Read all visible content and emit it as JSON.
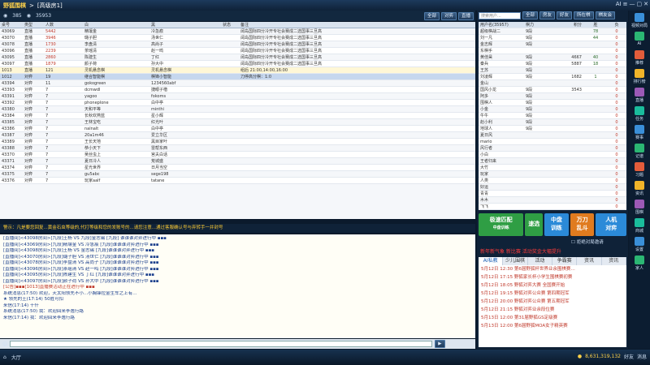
{
  "app": {
    "title": "野狐围棋",
    "room": "[高级房1]",
    "controls": [
      "AI",
      "≡",
      "—",
      "▢",
      "✕"
    ]
  },
  "info": {
    "num1": "385",
    "num2": "35953",
    "buttons": [
      "全部",
      "对弈",
      "直播"
    ]
  },
  "table": {
    "headers": [
      "桌号",
      "类型",
      "人数",
      "白",
      "黑",
      "状态",
      "备注"
    ],
    "rows": [
      [
        "43069",
        "直播",
        "5442",
        "精壤金",
        "冷急痕",
        "",
        "阔岛国际四分冷开专社会赛成二选国事三旦高"
      ],
      [
        "43070",
        "直播",
        "3946",
        "璐子胆",
        "汤世仁",
        "",
        "阔岛国际四分冷开专社会赛成二选国事三旦高"
      ],
      [
        "43078",
        "直播",
        "1730",
        "李盘清",
        "高尚子",
        "",
        "阔岛国际四分冷开专社会赛成二选国事三旦高"
      ],
      [
        "43096",
        "直播",
        "2239",
        "茶瑶清",
        "赵一鸣",
        "",
        "阔岛国际四分冷开专社会赛成二选国事三旦高"
      ],
      [
        "43095",
        "直播",
        "2860",
        "陈建生",
        "丁红",
        "",
        "阔岛国际四分冷开专社会赛成二选国事三旦高"
      ],
      [
        "43097",
        "直播",
        "1879",
        "颜子荷",
        "孙大中",
        "",
        "阔岛国际四分冷开专社会赛成二选国事三旦高"
      ],
      [
        "1013",
        "直播",
        "121",
        "灵机悬念棋",
        "灵机悬念棋",
        "",
        "组后 21:00,14:00,16:00"
      ],
      [
        "1012",
        "对弈",
        "19",
        "继合智能棋",
        "棋锋小智能",
        "",
        "刀停高分棋：1:0"
      ],
      [
        "43394",
        "对弈",
        "11",
        "gokogreen",
        "1234560abf",
        "",
        ""
      ],
      [
        "43393",
        "对弈",
        "7",
        "dcmwdl",
        "捷眼子楷",
        "",
        ""
      ],
      [
        "43391",
        "对弈",
        "7",
        "yagoo",
        "fokoms",
        "",
        ""
      ],
      [
        "43392",
        "对弈",
        "7",
        "phoneplone",
        "白中亭",
        "",
        ""
      ],
      [
        "43380",
        "对弈",
        "7",
        "天和平等",
        "minthi",
        "",
        ""
      ],
      [
        "43384",
        "对弈",
        "7",
        "长秋欢燕蓝",
        "星小辉",
        "",
        ""
      ],
      [
        "43385",
        "对弈",
        "7",
        "王林宝吃",
        "红光叶",
        "",
        ""
      ],
      [
        "43386",
        "对弈",
        "7",
        "nalnalt",
        "白中亭",
        "",
        ""
      ],
      [
        "43387",
        "对弈",
        "7",
        "20a1m46",
        "爱立华区",
        "",
        ""
      ],
      [
        "43389",
        "对弈",
        "7",
        "王长天地",
        "黑目家叶",
        "",
        ""
      ],
      [
        "43388",
        "对弈",
        "7",
        "恭小天下",
        "雷帮东西",
        "",
        ""
      ],
      [
        "43370",
        "对弈",
        "7",
        "吴丝虫上",
        "宫夫白话",
        "",
        ""
      ],
      [
        "43371",
        "对弈",
        "7",
        "夏日冷人",
        "荒城盛",
        "",
        ""
      ],
      [
        "43374",
        "对弈",
        "7",
        "星光世界",
        "日月当空",
        "",
        ""
      ],
      [
        "43375",
        "对弈",
        "7",
        "gu5abc",
        "sege198",
        "",
        ""
      ],
      [
        "43376",
        "对弈",
        "7",
        "玩家aalf",
        "tatane",
        "",
        ""
      ]
    ]
  },
  "notice": "警示：凡是要您回复...黄金石虫等级的,代打等级和您的发账号的...请您注意...通过客服确认号与弃转手一并封号",
  "chat": [
    {
      "t": "[直播间]<43098房间>[九段]王杨 VS 九段]金志锡 [九段] 谁谁谁对弈进行中 ▪▪▪",
      "red": false
    },
    {
      "t": "[直播间]<43069房间>[九段]精壤金 VS 冷急痕 [九段]谁谁谁对弈进行中 ▪▪▪",
      "red": false
    },
    {
      "t": "[直播间]<43098房间>[九段]王杨 VS 金志锡 [九段]谁谁谁对弈进行中 ▪▪▪",
      "red": false
    },
    {
      "t": "[直播间]<43070房间>[九段]璐子胆 VS 汤世仁 [九段]谁谁谁对弈进行中 ▪▪▪",
      "red": false
    },
    {
      "t": "[直播间]<43078房间>[九段]李盘清 VS 高尚子 [九段]谁谁谁对弈进行中 ▪▪▪",
      "red": false
    },
    {
      "t": "[直播间]<43096房间>[九段]茶瑶清 VS 赵一鸣 [九段]谁谁谁对弈进行中 ▪▪▪",
      "red": false
    },
    {
      "t": "[直播间]<43095房间>[九段]陈建生 VS 丁红 [九段]谁谁谁对弈进行中 ▪▪▪",
      "red": false
    },
    {
      "t": "[直播间]<43097房间>[九段]颜子荷 VS 孙大中 [九段]谁谁谁对弈进行中 ▪▪▪",
      "red": false
    },
    {
      "t": "[公告]▪▪▪[1013]直播赛活动正在进行中 ▪▪▪",
      "red": true
    },
    {
      "t": "系统消息(17:50) 欢迎，天太阳领先不小...小胸锋拉金生车之上有…",
      "red": false
    },
    {
      "t": "★ 领先的王(17:14) 50胜可扣",
      "red": false
    },
    {
      "t": "来信(17:14) 干什",
      "red": false
    },
    {
      "t": "系统消息(17:50) 我：欢迎回来李逸行路",
      "red": false
    },
    {
      "t": "来信(17:14) 我：欢迎回来李逸行路",
      "red": false
    }
  ],
  "players": {
    "headers": [
      "用户名(35957)",
      "棋力",
      "积分",
      "胜",
      "负"
    ],
    "rows": [
      [
        "超级棋战二",
        "9段",
        "",
        "78",
        "0"
      ],
      [
        "刘一凡",
        "9段",
        "",
        "44",
        "0"
      ],
      [
        "金志辉",
        "9段",
        "",
        "",
        "0"
      ],
      [
        "东棋手",
        "",
        "",
        "",
        "0"
      ],
      [
        "黄佳昊",
        "9段",
        "4667",
        "40",
        "0"
      ],
      [
        "秦兵",
        "9段",
        "5887",
        "18",
        "0"
      ],
      [
        "王苏",
        "9段",
        "",
        "",
        "0"
      ],
      [
        "刘凌辉",
        "9段",
        "1682",
        "1",
        "0"
      ],
      [
        "金山",
        "",
        "",
        "",
        "0"
      ],
      [
        "国风小龙",
        "9段",
        "3543",
        "",
        "0"
      ],
      [
        "阿多",
        "9段",
        "",
        "",
        "0"
      ],
      [
        "围棋人",
        "9段",
        "",
        "",
        "0"
      ],
      [
        "小金",
        "9段",
        "",
        "",
        "0"
      ],
      [
        "牛牛",
        "9段",
        "",
        "",
        "0"
      ],
      [
        "赵小利",
        "9段",
        "",
        "",
        "0"
      ],
      [
        "地球人",
        "9段",
        "",
        "",
        "0"
      ],
      [
        "夏日风",
        "",
        "",
        "",
        "0"
      ],
      [
        "mario",
        "",
        "",
        "",
        "0"
      ],
      [
        "风行者",
        "",
        "",
        "",
        "0"
      ],
      [
        "小白",
        "",
        "",
        "",
        "0"
      ],
      [
        "王者归来",
        "",
        "",
        "",
        "0"
      ],
      [
        "大竹",
        "",
        "",
        "",
        "0"
      ],
      [
        "玩家",
        "",
        "",
        "",
        "0"
      ],
      [
        "人类",
        "",
        "",
        "",
        "0"
      ],
      [
        "好运",
        "",
        "",
        "",
        "0"
      ],
      [
        "青青",
        "",
        "",
        "",
        "0"
      ],
      [
        "木木",
        "",
        "",
        "",
        "0"
      ],
      [
        "飞飞",
        "",
        "",
        "",
        "0"
      ]
    ]
  },
  "right_tabs": [
    "全部",
    "房友",
    "好友",
    "所在棋",
    "棋友会"
  ],
  "search_placeholder": "搜索用户...",
  "match": {
    "b1": "极速匹配",
    "b1s": "中盘训练",
    "b2": "速选",
    "b3": "中盘",
    "b3s": "训练",
    "b4": "万刀",
    "b4s": "乱斗",
    "b5": "人机",
    "b5s": "对弈",
    "chk": "拒绝对局邀请",
    "ad": "新年新气象 新比赛 活动奖金大幅提升"
  },
  "news": {
    "tabs": [
      "AI私教",
      "少儿围棋",
      "活动",
      "争霸赛",
      "资讯",
      "资讯"
    ],
    "items": [
      "5月12日 12:30 第6届野狐杯世界业余围棋赛…",
      "5月12日 17:15 野狐家长杯小学生围棋赛初赛",
      "5月12日 18:05 野狐对弈大赛 全国赛开始",
      "5月12日 19:15 野狐对弈公众赛 第四期冠军",
      "5月12日 20:00 野狐对弈公众赛 第五期冠军",
      "5月12日 21:15 野狐对弈业余段位赛",
      "5月13日 12:00 第31届野狐GS定级赛",
      "5月13日 12:00 第6届野狐MOA女子精英赛"
    ]
  },
  "sidebar": [
    "视频对局",
    "AI",
    "推荐",
    "排行榜",
    "直播",
    "任务",
    "赛事",
    "记谱",
    "习题",
    "资讯",
    "围棋",
    "商城",
    "设置",
    "家人"
  ],
  "bottom": {
    "left": "大厅",
    "coins": "8,631,319,132",
    "right": [
      "好友",
      "消息"
    ]
  }
}
